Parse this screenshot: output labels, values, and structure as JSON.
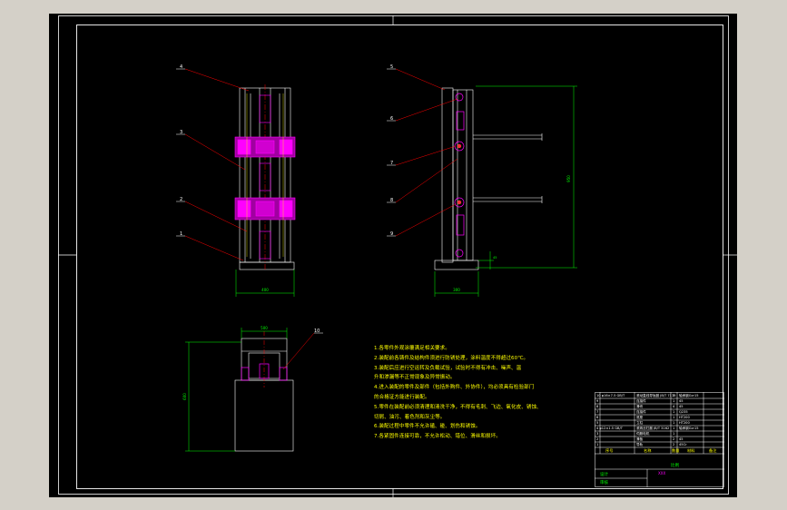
{
  "callouts": {
    "front_view": [
      "4",
      "3",
      "2",
      "1"
    ],
    "side_view": [
      "5",
      "6",
      "7",
      "8",
      "9"
    ],
    "top_view": [
      "10"
    ]
  },
  "dimensions": {
    "front_width": "400",
    "side_height": "950",
    "side_width": "300",
    "side_foot": "45",
    "top_width": "500",
    "top_height": "25",
    "top_side": "600"
  },
  "notes": [
    "1.各零件外观涂覆满足相关要求。",
    "2.装配前各铸件及结构件须进行防锈处理，涂料温度不得超过60℃。",
    "3.装配后应进行空运转及负载试验，试验时不得有冲击、噪声、温",
    "升和渗漏等不正常现象及异常振动。",
    "4.进入装配的零件及部件（包括外购件、外协件），均必须具有检验部门",
    "的合格证方能进行装配。",
    "5.零件在装配前必须清理和清洗干净，不得有毛刺、飞边、氧化皮、锈蚀、",
    "切屑、油污、着色剂和灰尘等。",
    "6.装配过程中零件不允许磕、碰、划伤和锈蚀。",
    "7.各紧固件连接可靠，不允许松动、错位、滑丝和损坏。"
  ],
  "title_block": {
    "rows": [
      {
        "left": "10 φ16×7.5 GB/T",
        "mid": "滚动直线导轨副 JB/T 7175",
        "qty": "2",
        "mat": "轴承钢Gcr15"
      },
      {
        "left": "9",
        "mid": "连接件",
        "qty": "1",
        "mat": "45"
      },
      {
        "left": "8",
        "mid": "滑块",
        "qty": "4",
        "mat": "45"
      },
      {
        "left": "7",
        "mid": "连接件",
        "qty": "1",
        "mat": "Q235"
      },
      {
        "left": "6",
        "mid": "底座",
        "qty": "1",
        "mat": "HT200"
      },
      {
        "left": "5",
        "mid": "立柱",
        "qty": "1",
        "mat": "HT200"
      },
      {
        "left": "4 φ12×1.5 GB/T",
        "mid": "滚珠丝杠副 JB/T 3162",
        "qty": "1",
        "mat": "轴承钢Gcr15"
      },
      {
        "left": "3",
        "mid": "伺服电机",
        "qty": "1",
        "mat": ""
      },
      {
        "left": "2",
        "mid": "滑板",
        "qty": "2",
        "mat": "45"
      },
      {
        "left": "1",
        "mid": "导轨",
        "qty": "2",
        "mat": "45Cr"
      }
    ],
    "header": {
      "no": "序号",
      "name": "名称",
      "qty": "数量",
      "mat": "材料",
      "note": "备注"
    },
    "bottom_left": [
      "设计",
      "审核"
    ],
    "bottom_mid": "XXX",
    "bottom_right": "比例"
  },
  "colors": {
    "background": "#000000",
    "frame": "#ffffff",
    "outline": "#ffffff",
    "dimension": "#00ff00",
    "callout_leader": "#ff0000",
    "highlight_part": "#ff00ff",
    "notes_text": "#ffff00",
    "window_chrome": "#d4d0c8"
  }
}
